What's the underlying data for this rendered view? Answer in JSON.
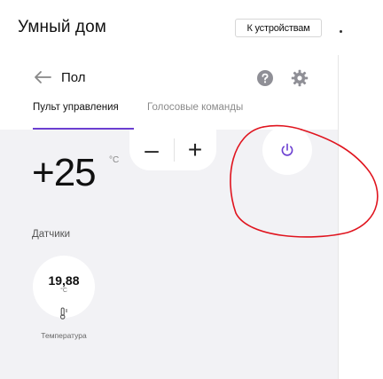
{
  "app": {
    "title": "Умный дом"
  },
  "header": {
    "devices_button": "К устройствам"
  },
  "device": {
    "title": "Пол"
  },
  "tabs": [
    {
      "label": "Пульт управления",
      "active": true
    },
    {
      "label": "Голосовые команды",
      "active": false
    }
  ],
  "control": {
    "temperature": "+25",
    "unit": "°C",
    "minus_label": "–",
    "plus_label": "+"
  },
  "sensors": {
    "title": "Датчики",
    "items": [
      {
        "value": "19,88",
        "unit": "°C",
        "label": "Температура",
        "icon": "thermometer-icon"
      }
    ]
  },
  "icons": {
    "back": "arrow-left-icon",
    "help": "question-circle-icon",
    "settings": "gear-icon",
    "power": "power-icon"
  },
  "colors": {
    "accent": "#6b3fd1",
    "panel_bg": "#f2f2f5",
    "annotation": "#e0141e"
  }
}
